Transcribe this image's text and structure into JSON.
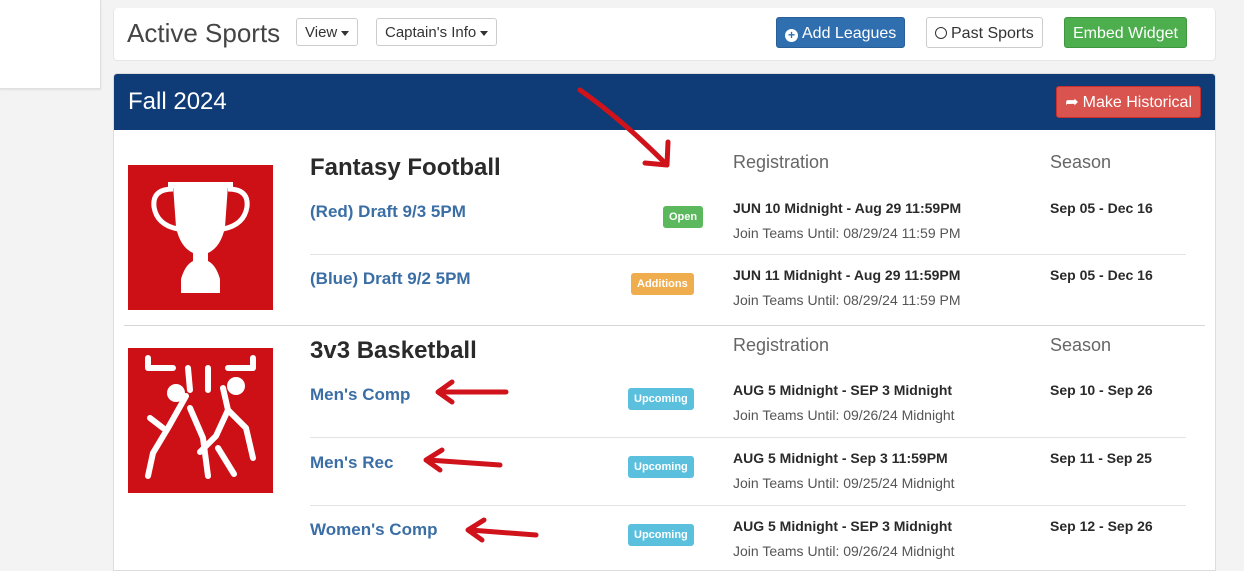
{
  "page": {
    "title": "Active Sports"
  },
  "toolbar": {
    "view_label": "View",
    "captain_label": "Captain's Info",
    "add_leagues_label": "Add Leagues",
    "past_sports_label": "Past Sports",
    "embed_widget_label": "Embed Widget"
  },
  "season": {
    "title": "Fall 2024",
    "make_historical_label": "Make Historical"
  },
  "sports": [
    {
      "name": "Fantasy Football",
      "registration_header": "Registration",
      "season_header": "Season",
      "icon": "trophy-icon",
      "leagues": [
        {
          "name": "(Red) Draft 9/3 5PM",
          "status": "Open",
          "registration": "JUN 10 Midnight - Aug 29 11:59PM",
          "join_until": "Join Teams Until: 08/29/24 11:59 PM",
          "season": "Sep 05 - Dec 16"
        },
        {
          "name": "(Blue) Draft 9/2 5PM",
          "status": "Additions",
          "registration": "JUN 11 Midnight - Aug 29 11:59PM",
          "join_until": "Join Teams Until: 08/29/24 11:59 PM",
          "season": "Sep 05 - Dec 16"
        }
      ]
    },
    {
      "name": "3v3 Basketball",
      "registration_header": "Registration",
      "season_header": "Season",
      "icon": "basketball-players-icon",
      "leagues": [
        {
          "name": "Men's Comp",
          "status": "Upcoming",
          "registration": "AUG 5 Midnight - SEP 3 Midnight",
          "join_until": "Join Teams Until: 09/26/24 Midnight",
          "season": "Sep 10 - Sep 26"
        },
        {
          "name": "Men's Rec",
          "status": "Upcoming",
          "registration": "AUG 5 Midnight - Sep 3 11:59PM",
          "join_until": "Join Teams Until: 09/25/24 Midnight",
          "season": "Sep 11 - Sep 25"
        },
        {
          "name": "Women's Comp",
          "status": "Upcoming",
          "registration": "AUG 5 Midnight - SEP 3 Midnight",
          "join_until": "Join Teams Until: 09/26/24 Midnight",
          "season": "Sep 12 - Sep 26"
        }
      ]
    }
  ],
  "colors": {
    "header_navy": "#0f3c77",
    "open_green": "#5cb85c",
    "additions_orange": "#f0ad4e",
    "upcoming_blue": "#5bc0de",
    "danger_red": "#d9534f",
    "annotation_red": "#d0121b"
  }
}
